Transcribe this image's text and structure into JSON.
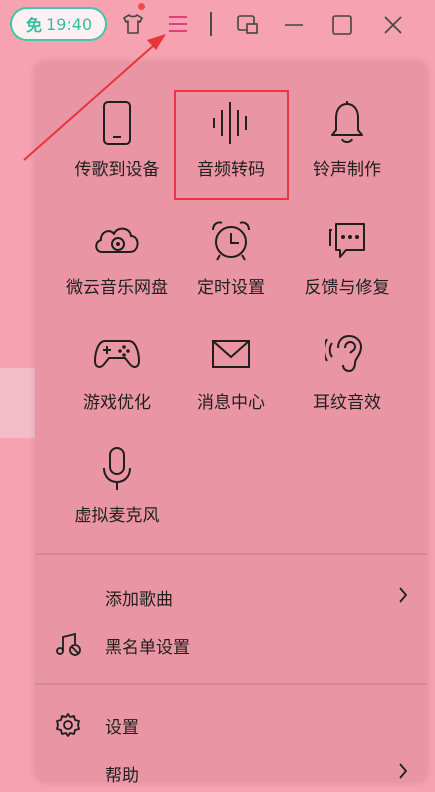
{
  "topbar": {
    "vip_badge": "免",
    "time": "19:40",
    "icons": [
      "tshirt-icon",
      "menu-icon",
      "miniplayer-icon",
      "minimize-icon",
      "maximize-icon",
      "close-icon"
    ]
  },
  "grid_items": [
    {
      "label": "传歌到设备",
      "icon": "phone-icon"
    },
    {
      "label": "音频转码",
      "icon": "waveform-icon"
    },
    {
      "label": "铃声制作",
      "icon": "bell-icon"
    },
    {
      "label": "微云音乐网盘",
      "icon": "cloud-icon"
    },
    {
      "label": "定时设置",
      "icon": "alarm-clock-icon"
    },
    {
      "label": "反馈与修复",
      "icon": "feedback-icon"
    },
    {
      "label": "游戏优化",
      "icon": "gamepad-icon"
    },
    {
      "label": "消息中心",
      "icon": "mail-icon"
    },
    {
      "label": "耳纹音效",
      "icon": "ear-icon"
    },
    {
      "label": "虚拟麦克风",
      "icon": "microphone-icon"
    }
  ],
  "list_items": [
    {
      "label": "添加歌曲",
      "has_submenu": true
    },
    {
      "label": "黑名单设置",
      "has_submenu": false,
      "icon": "music-block-icon"
    },
    {
      "label": "设置",
      "has_submenu": false,
      "icon": "gear-icon"
    },
    {
      "label": "帮助",
      "has_submenu": true
    }
  ],
  "colors": {
    "background": "#f6a2b1",
    "menu": "#ea95a4",
    "accent_green": "#3fc8a6",
    "highlight_red": "#e8383d"
  }
}
